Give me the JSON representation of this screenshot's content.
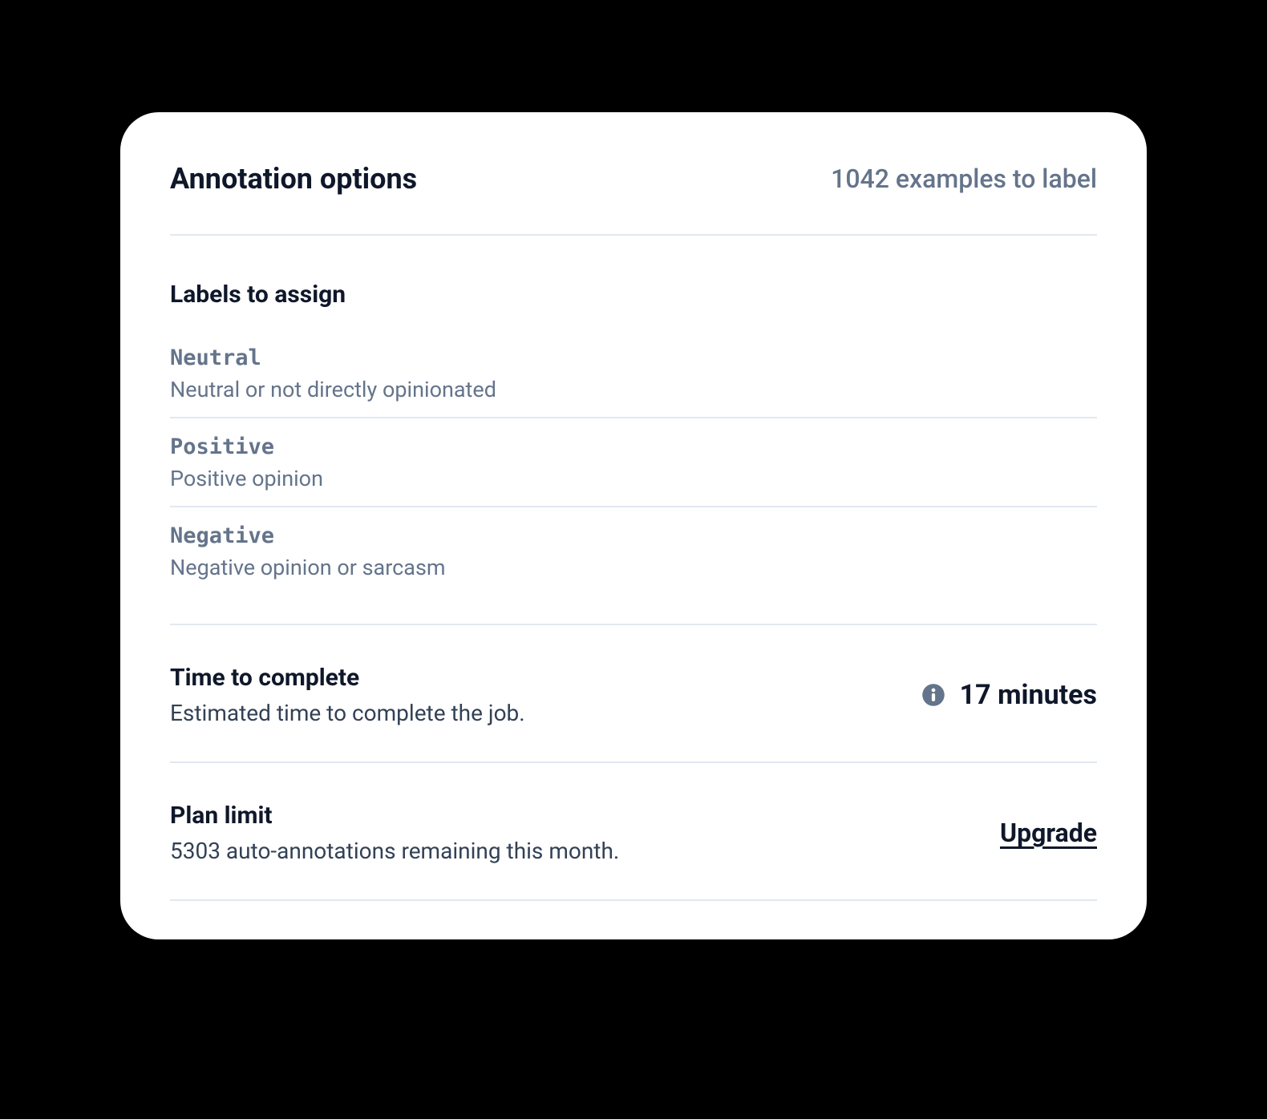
{
  "header": {
    "title": "Annotation options",
    "example_count_text": "1042 examples to label"
  },
  "labels_section": {
    "heading": "Labels to assign",
    "items": [
      {
        "name": "Neutral",
        "description": "Neutral or not directly opinionated"
      },
      {
        "name": "Positive",
        "description": "Positive opinion"
      },
      {
        "name": "Negative",
        "description": "Negative opinion or sarcasm"
      }
    ]
  },
  "time_section": {
    "title": "Time to complete",
    "subtitle": "Estimated time to complete the job.",
    "value": "17 minutes",
    "info_icon": "info-icon"
  },
  "plan_section": {
    "title": "Plan limit",
    "subtitle": "5303 auto-annotations remaining this month.",
    "upgrade_label": "Upgrade"
  }
}
